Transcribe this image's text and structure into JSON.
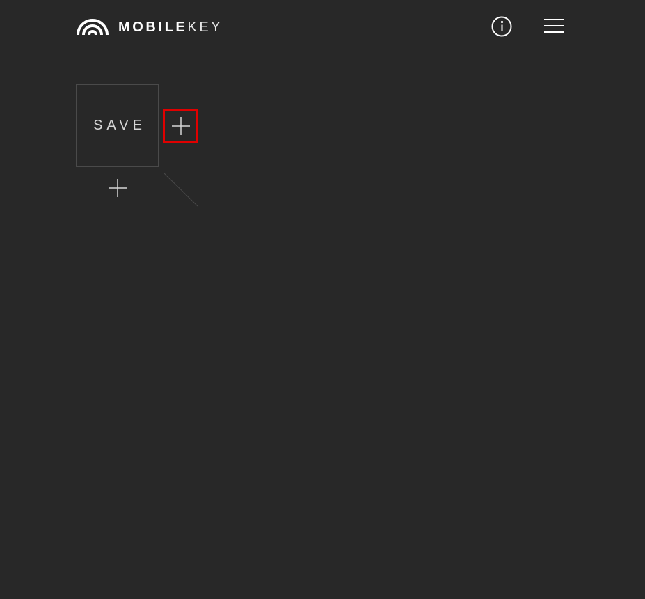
{
  "header": {
    "brand_primary": "MOBILE",
    "brand_secondary": "KEY",
    "logo_icon": "rainbow-arc-icon",
    "info_icon": "info-circle-icon",
    "menu_icon": "hamburger-menu-icon"
  },
  "main": {
    "save_label": "SAVE",
    "add_icon": "plus-icon"
  },
  "colors": {
    "background": "#282828",
    "foreground": "#ffffff",
    "tile_border": "#4a4a4a",
    "highlight": "#e00000"
  }
}
